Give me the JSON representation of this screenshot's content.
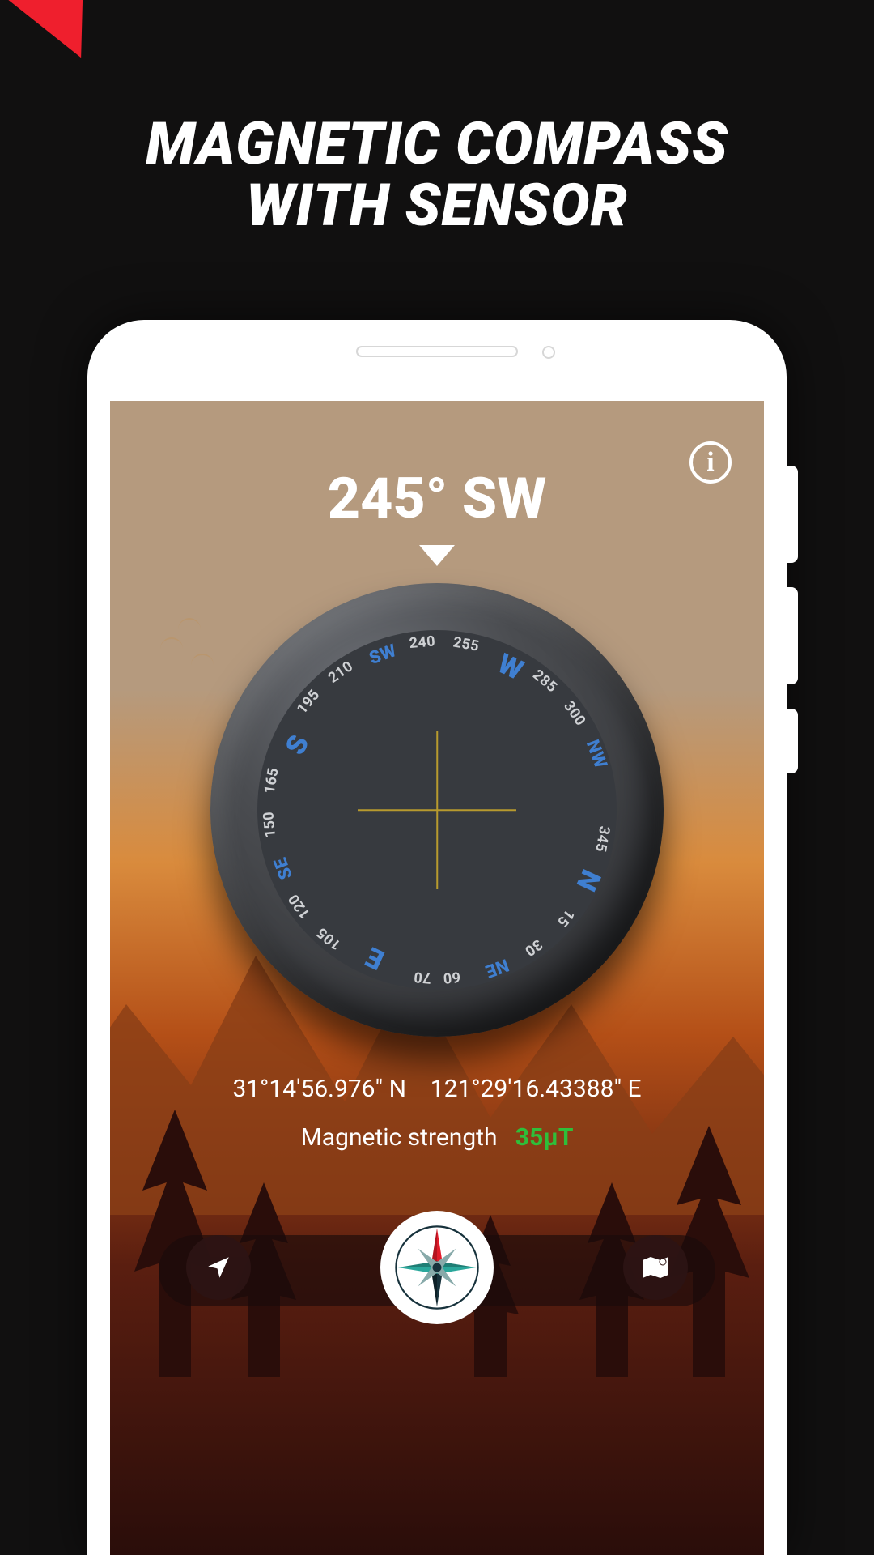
{
  "promo": {
    "headline_line1": "MAGNETIC COMPASS",
    "headline_line2": "WITH SENSOR"
  },
  "compass": {
    "heading_deg": 245,
    "heading_dir": "SW",
    "heading_text": "245° SW",
    "latitude": "31°14'56.976\" N",
    "longitude": "121°29'16.43388\" E",
    "magnetic_label": "Magnetic strength",
    "magnetic_value": "35µT",
    "info_icon": "i",
    "cardinals": [
      {
        "label": "N",
        "deg": 0,
        "kind": "card"
      },
      {
        "label": "NE",
        "deg": 45,
        "kind": "inter"
      },
      {
        "label": "E",
        "deg": 90,
        "kind": "card"
      },
      {
        "label": "SE",
        "deg": 135,
        "kind": "inter"
      },
      {
        "label": "S",
        "deg": 180,
        "kind": "card"
      },
      {
        "label": "SW",
        "deg": 225,
        "kind": "inter"
      },
      {
        "label": "W",
        "deg": 270,
        "kind": "card"
      },
      {
        "label": "NW",
        "deg": 315,
        "kind": "inter"
      }
    ],
    "ticks": [
      15,
      30,
      60,
      70,
      105,
      120,
      150,
      165,
      195,
      210,
      240,
      255,
      285,
      300,
      345
    ]
  },
  "nav": {
    "left_icon": "navigate-arrow-icon",
    "center_icon": "compass-rose-icon",
    "right_icon": "map-icon"
  }
}
